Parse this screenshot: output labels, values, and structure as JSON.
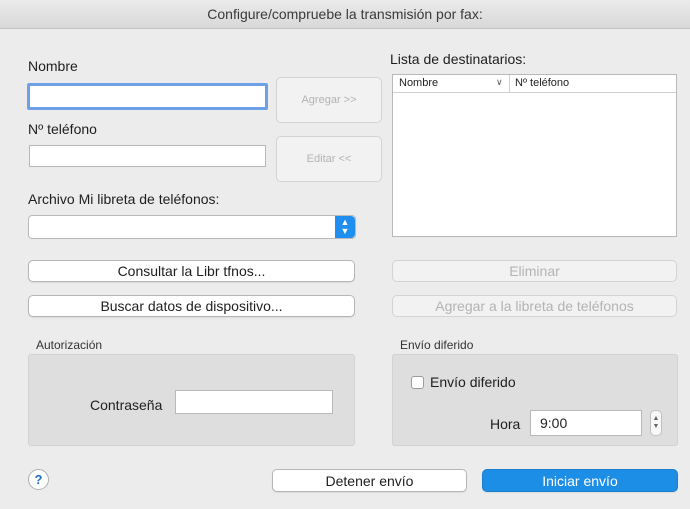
{
  "window": {
    "title": "Configure/compruebe la transmisión por fax:"
  },
  "left": {
    "name_label": "Nombre",
    "phone_label": "Nº teléfono",
    "phonebook_label": "Archivo Mi libreta de teléfonos:",
    "name_value": "",
    "phone_value": "",
    "phonebook_value": ""
  },
  "middle": {
    "add_label": "Agregar  >>",
    "edit_label": "Editar <<"
  },
  "recipients": {
    "label": "Lista de destinatarios:",
    "col_name": "Nombre",
    "col_sort_icon": "chevron-down",
    "col_phone": "Nº teléfono"
  },
  "buttons": {
    "consult": "Consultar la Libr tfnos...",
    "search": "Buscar datos de dispositivo...",
    "delete": "Eliminar",
    "add_phonebook": "Agregar a la libreta de teléfonos",
    "stop": "Detener envío",
    "start": "Iniciar envío",
    "help": "?"
  },
  "auth": {
    "title": "Autorización",
    "password_label": "Contraseña",
    "password_value": ""
  },
  "deferred": {
    "title": "Envío diferido",
    "checkbox_label": "Envío diferido",
    "checked": false,
    "time_label": "Hora",
    "time_value": "9:00"
  },
  "colors": {
    "accent": "#1d8ee6",
    "focus": "#6ea0e8",
    "panel": "#dedede"
  }
}
